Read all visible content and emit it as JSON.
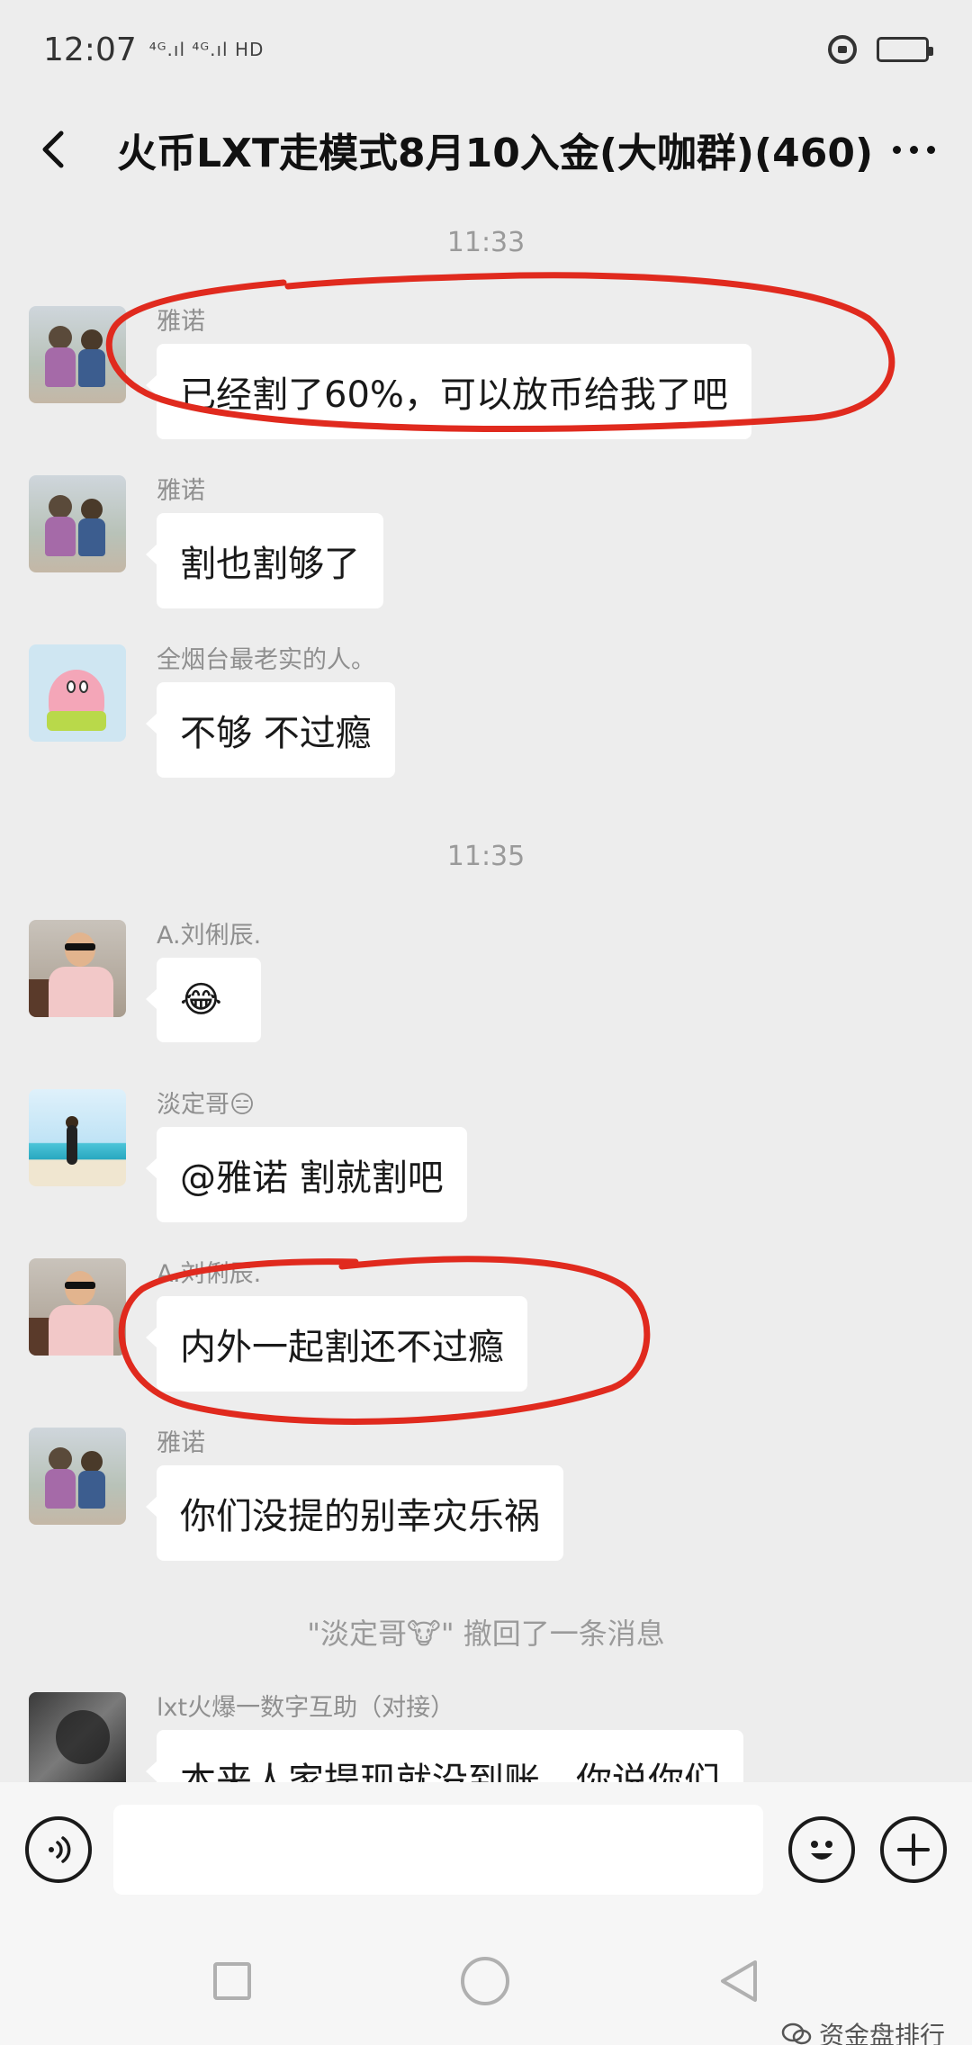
{
  "status_bar": {
    "time": "12:07",
    "signal_text": "⁴ᴳ.ıl ⁴ᴳ.ıl HD",
    "lock_icon": "lock-rotation-icon",
    "battery_icon": "battery-icon"
  },
  "header": {
    "back_icon": "back-chevron-icon",
    "title": "火币LXT走模式8月10入金(大咖群)(460)",
    "more_icon": "more-dots-icon"
  },
  "messages": {
    "time_1": "11:33",
    "time_2": "11:35",
    "items": [
      {
        "sender": "雅诺",
        "text": "已经割了60%，可以放币给我了吧",
        "avatar": "kids-photo"
      },
      {
        "sender": "雅诺",
        "text": "割也割够了",
        "avatar": "kids-photo"
      },
      {
        "sender": "全烟台最老实的人。",
        "text": "不够 不过瘾",
        "avatar": "patrick-star"
      },
      {
        "sender": "A.刘俐辰.",
        "text": "😂",
        "avatar": "man-sunglasses"
      },
      {
        "sender": "淡定哥😑",
        "text": "@雅诺  割就割吧",
        "avatar": "beach-photo"
      },
      {
        "sender": "A.刘俐辰.",
        "text": "内外一起割还不过瘾",
        "avatar": "man-sunglasses"
      },
      {
        "sender": "雅诺",
        "text": "你们没提的别幸灾乐祸",
        "avatar": "kids-photo"
      },
      {
        "sender": "lxt火爆一数字互助（对接）",
        "text": "本来人家提现就没到账，你说你们",
        "avatar": "dark-photo"
      }
    ],
    "recall_notice": "\"淡定哥🐮\" 撤回了一条消息"
  },
  "input_bar": {
    "voice_icon": "voice-icon",
    "text_value": "",
    "emoji_icon": "emoji-icon",
    "plus_icon": "plus-icon"
  },
  "nav": {
    "recent_icon": "square-recent-icon",
    "home_icon": "circle-home-icon",
    "back_icon": "triangle-back-icon"
  },
  "watermark": {
    "text": "资金盘排行"
  },
  "colors": {
    "background": "#ededed",
    "bubble": "#ffffff",
    "annotation_red": "#e02a1e",
    "sender_gray": "#8f8f8f"
  }
}
